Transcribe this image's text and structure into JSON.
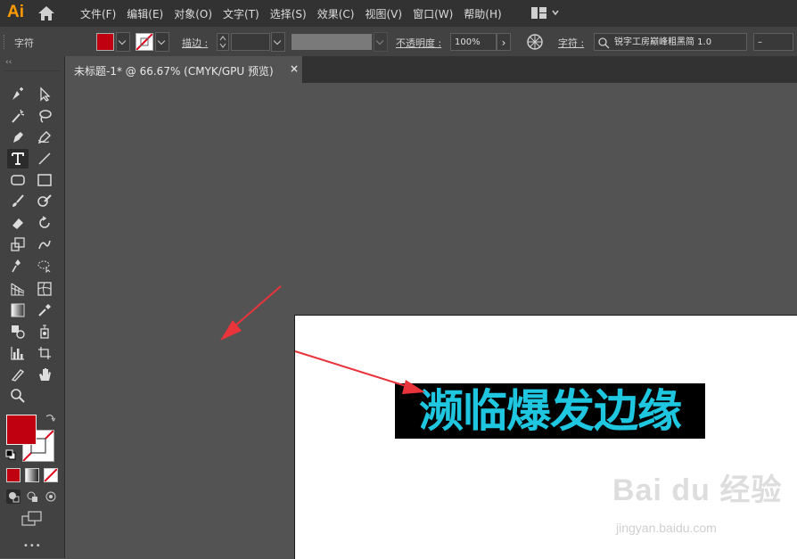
{
  "app": {
    "logo": "Ai"
  },
  "menu": [
    "文件(F)",
    "编辑(E)",
    "对象(O)",
    "文字(T)",
    "选择(S)",
    "效果(C)",
    "视图(V)",
    "窗口(W)",
    "帮助(H)"
  ],
  "control_bar": {
    "panel_label": "字符",
    "stroke_label": "描边 :",
    "opacity_label": "不透明度 :",
    "opacity_value": "100%",
    "char_label": "字符 :",
    "font_value": "锐字工房巅峰粗黑简 1.0",
    "style_value": "–",
    "fill_color": "#c00010"
  },
  "toolbar": {
    "collapse_glyph": "‹‹",
    "more_glyph": "•••",
    "fill_color": "#c00010"
  },
  "document_tab": {
    "title": "未标题-1* @ 66.67% (CMYK/GPU 预览)",
    "close": "×"
  },
  "artwork": {
    "text": "濒临爆发边缘",
    "text_color": "#1fc6e0",
    "box_color": "#000000"
  },
  "annotation": {
    "arrow_color": "#e8343a"
  },
  "watermark": {
    "brand": "Bai du 经验",
    "url": "jingyan.baidu.com"
  }
}
